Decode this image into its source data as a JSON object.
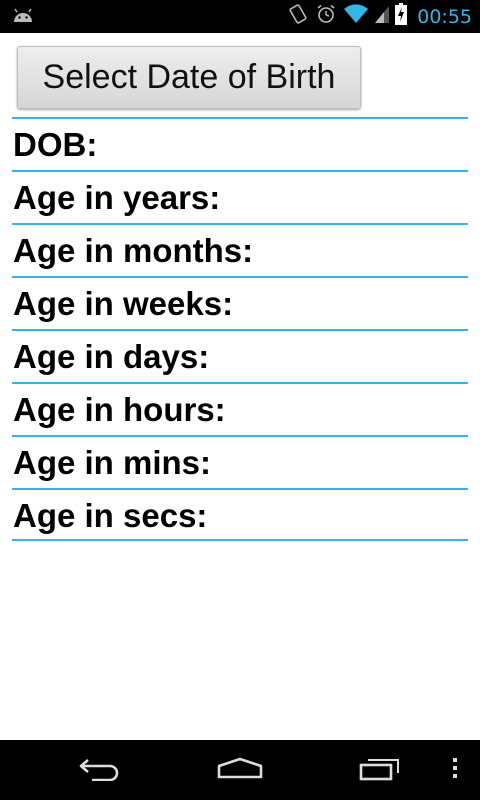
{
  "status_bar": {
    "time": "00:55",
    "icons": [
      "android-debug-icon",
      "screen-rotate-icon",
      "alarm-icon",
      "wifi-icon",
      "signal-icon",
      "battery-charging-icon"
    ]
  },
  "main": {
    "select_button_label": "Select Date of Birth",
    "rows": [
      {
        "label": "DOB:"
      },
      {
        "label": "Age in years:"
      },
      {
        "label": "Age in months:"
      },
      {
        "label": "Age in weeks:"
      },
      {
        "label": "Age in days:"
      },
      {
        "label": "Age in hours:"
      },
      {
        "label": "Age in mins:"
      },
      {
        "label": "Age in secs:"
      }
    ]
  },
  "nav_bar": {
    "icons": [
      "back-icon",
      "home-icon",
      "recent-apps-icon",
      "menu-icon"
    ]
  },
  "colors": {
    "accent": "#33b5e5",
    "status_bar": "#000000",
    "nav_bar": "#000000",
    "background": "#ffffff"
  }
}
